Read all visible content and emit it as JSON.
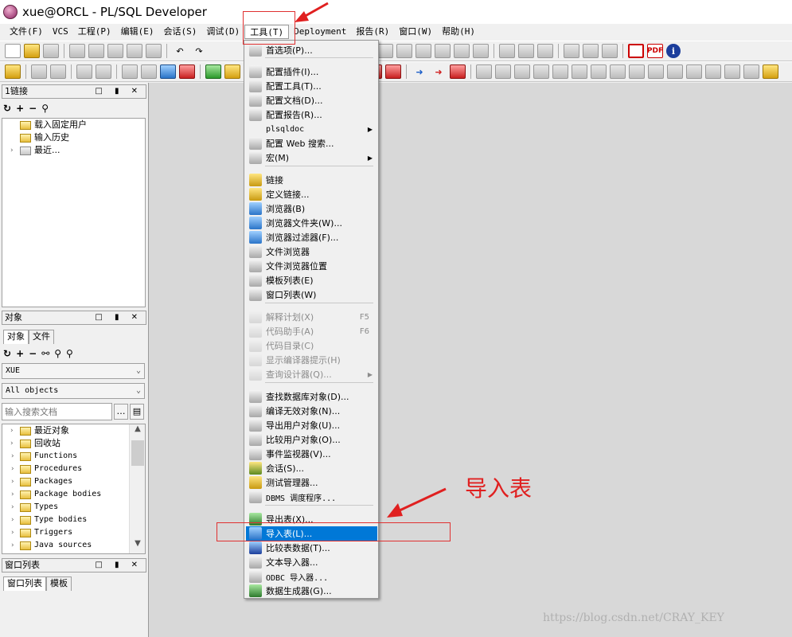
{
  "window": {
    "title": "xue@ORCL - PL/SQL Developer"
  },
  "menubar": [
    "文件(F)",
    "VCS",
    "工程(P)",
    "编辑(E)",
    "会话(S)",
    "调试(D)",
    "工具(T)",
    "Deployment",
    "报告(R)",
    "窗口(W)",
    "帮助(H)"
  ],
  "active_menu": "工具(T)",
  "tools_menu": {
    "items": [
      {
        "label": "首选项(P)...",
        "state": "normal",
        "icon": "wrench-icon"
      },
      {
        "label": "配置插件(I)...",
        "state": "normal",
        "icon": "plugin-icon"
      },
      {
        "label": "配置工具(T)...",
        "state": "normal",
        "icon": "tools-icon"
      },
      {
        "label": "配置文档(D)...",
        "state": "normal",
        "icon": "document-icon"
      },
      {
        "label": "配置报告(R)...",
        "state": "normal",
        "icon": "report-icon"
      },
      {
        "label": "plsqldoc",
        "state": "submenu",
        "icon": "none"
      },
      {
        "label": "配置 Web 搜索...",
        "state": "normal",
        "icon": "web-search-icon"
      },
      {
        "label": "宏(M)",
        "state": "submenu",
        "icon": "macro-icon"
      },
      {
        "label": "链接",
        "state": "normal",
        "icon": "database-icon"
      },
      {
        "label": "定义链接...",
        "state": "normal",
        "icon": "database-icon"
      },
      {
        "label": "浏览器(B)",
        "state": "normal",
        "icon": "browser-icon"
      },
      {
        "label": "浏览器文件夹(W)...",
        "state": "normal",
        "icon": "browser-folder-icon"
      },
      {
        "label": "浏览器过滤器(F)...",
        "state": "normal",
        "icon": "browser-filter-icon"
      },
      {
        "label": "文件浏览器",
        "state": "normal",
        "icon": "file-browser-icon"
      },
      {
        "label": "文件浏览器位置",
        "state": "normal",
        "icon": "file-browser-location-icon"
      },
      {
        "label": "模板列表(E)",
        "state": "normal",
        "icon": "template-list-icon"
      },
      {
        "label": "窗口列表(W)",
        "state": "normal",
        "icon": "window-list-icon"
      },
      {
        "label": "解释计划(X)",
        "state": "disabled",
        "shortcut": "F5",
        "icon": "explain-plan-icon"
      },
      {
        "label": "代码助手(A)",
        "state": "disabled",
        "shortcut": "F6",
        "icon": "code-assistant-icon"
      },
      {
        "label": "代码目录(C)",
        "state": "disabled",
        "icon": "code-contents-icon"
      },
      {
        "label": "显示编译器提示(H)",
        "state": "disabled",
        "icon": "compiler-hints-icon"
      },
      {
        "label": "查询设计器(Q)...",
        "state": "disabled-submenu",
        "icon": "query-designer-icon"
      },
      {
        "label": "查找数据库对象(D)...",
        "state": "normal",
        "icon": "find-objects-icon"
      },
      {
        "label": "编译无效对象(N)...",
        "state": "normal",
        "icon": "compile-invalid-icon"
      },
      {
        "label": "导出用户对象(U)...",
        "state": "normal",
        "icon": "export-user-objects-icon"
      },
      {
        "label": "比较用户对象(O)...",
        "state": "normal",
        "icon": "compare-user-objects-icon"
      },
      {
        "label": "事件监视器(V)...",
        "state": "normal",
        "icon": "event-monitor-icon"
      },
      {
        "label": "会话(S)...",
        "state": "normal",
        "icon": "sessions-icon"
      },
      {
        "label": "测试管理器...",
        "state": "normal",
        "icon": "test-manager-icon"
      },
      {
        "label": "DBMS 调度程序...",
        "state": "normal",
        "icon": "dbms-scheduler-icon"
      },
      {
        "label": "导出表(X)...",
        "state": "normal",
        "icon": "export-tables-icon"
      },
      {
        "label": "导入表(L)...",
        "state": "selected",
        "icon": "import-tables-icon"
      },
      {
        "label": "比较表数据(T)...",
        "state": "normal",
        "icon": "compare-table-data-icon"
      },
      {
        "label": "文本导入器...",
        "state": "normal",
        "icon": "text-importer-icon"
      },
      {
        "label": "ODBC 导入器...",
        "state": "normal",
        "icon": "odbc-importer-icon"
      },
      {
        "label": "数据生成器(G)...",
        "state": "normal",
        "icon": "data-generator-icon"
      }
    ]
  },
  "connection_panel": {
    "header": "1链接",
    "items": [
      "载入固定用户",
      "输入历史",
      "最近..."
    ]
  },
  "objects_panel": {
    "header": "对象",
    "tabs": [
      "对象",
      "文件"
    ],
    "user_select": "XUE",
    "filter_select": "All objects",
    "search_placeholder": "输入搜索文档",
    "items": [
      "最近对象",
      "回收站",
      "Functions",
      "Procedures",
      "Packages",
      "Package bodies",
      "Types",
      "Type bodies",
      "Triggers",
      "Java sources"
    ]
  },
  "window_list_panel": {
    "header": "窗口列表",
    "tabs": [
      "窗口列表",
      "模板"
    ]
  },
  "annotation": {
    "text": "导入表"
  },
  "watermark": "https://blog.csdn.net/CRAY_KEY",
  "colors": {
    "selected": "#0078d7",
    "annotation": "#e02020"
  }
}
